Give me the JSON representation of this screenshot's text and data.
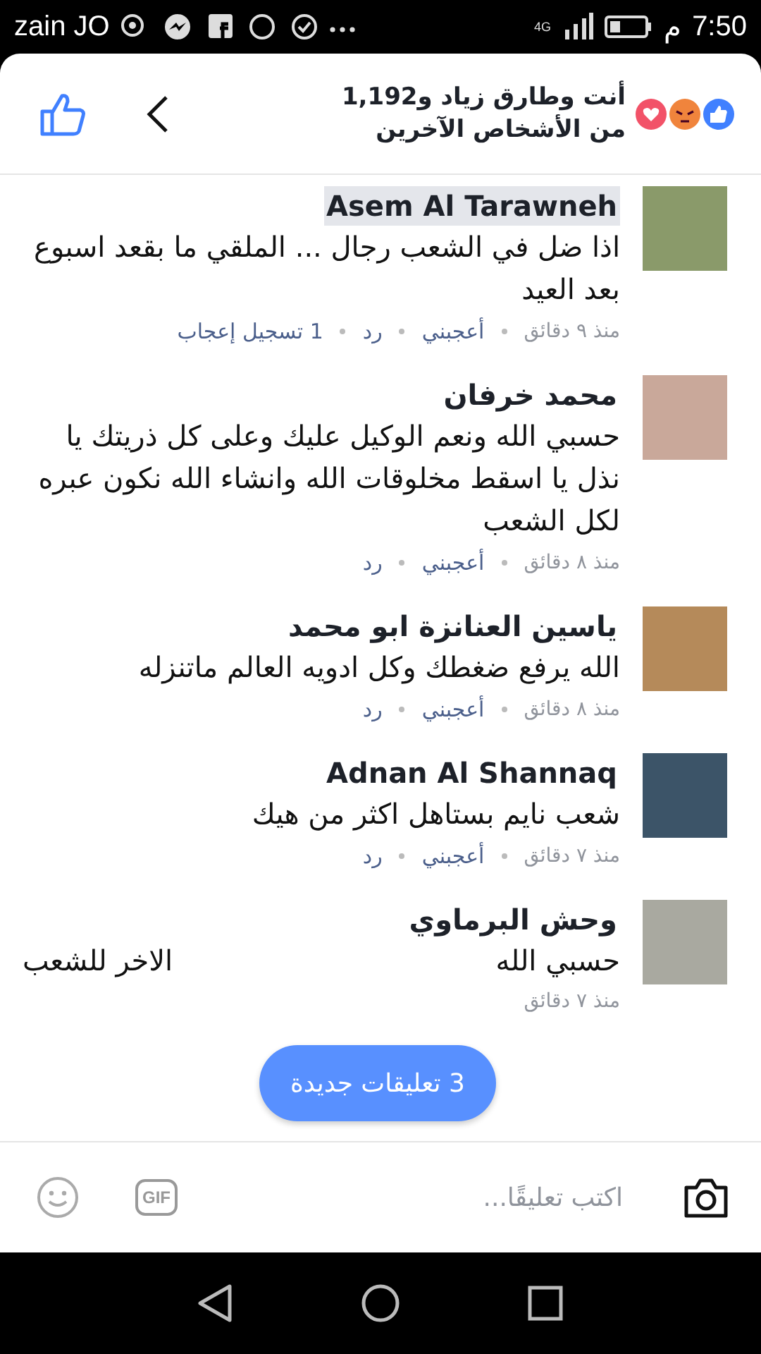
{
  "status_bar": {
    "carrier": "zain JO",
    "network": "4G",
    "am_pm": "م",
    "time": "7:50"
  },
  "header": {
    "reactions_text": "أنت وطارق زياد و1,192 من الأشخاص الآخرين"
  },
  "comments": [
    {
      "author": "Asem Al Tarawneh",
      "highlighted": true,
      "text": "اذا ضل في الشعب رجال ... الملقي ما بقعد اسبوع بعد العيد",
      "time": "منذ ٩ دقائق",
      "like": "أعجبني",
      "reply": "رد",
      "likes_count": "1 تسجيل إعجاب"
    },
    {
      "author": "محمد خرفان",
      "highlighted": false,
      "text": "حسبي الله ونعم الوكيل عليك وعلى كل ذريتك يا نذل يا اسقط مخلوقات الله وانشاء الله نكون عبره لكل الشعب",
      "time": "منذ ٨ دقائق",
      "like": "أعجبني",
      "reply": "رد"
    },
    {
      "author": "ياسين العنانزة ابو محمد",
      "highlighted": false,
      "text": "الله يرفع ضغطك وكل ادويه العالم ماتنزله",
      "time": "منذ ٨ دقائق",
      "like": "أعجبني",
      "reply": "رد"
    },
    {
      "author": "Adnan Al Shannaq",
      "highlighted": false,
      "text": "شعب نايم بستاهل اكثر من هيك",
      "time": "منذ ٧ دقائق",
      "like": "أعجبني",
      "reply": "رد"
    },
    {
      "author": "وحش البرماوي",
      "highlighted": false,
      "text_parts": [
        "حسبي الله",
        "الاخر للشعب"
      ],
      "time": "منذ ٧ دقائق"
    }
  ],
  "new_comments_button": "3 تعليقات جديدة",
  "composer": {
    "placeholder": "اكتب تعليقًا...",
    "gif_label": "GIF"
  }
}
